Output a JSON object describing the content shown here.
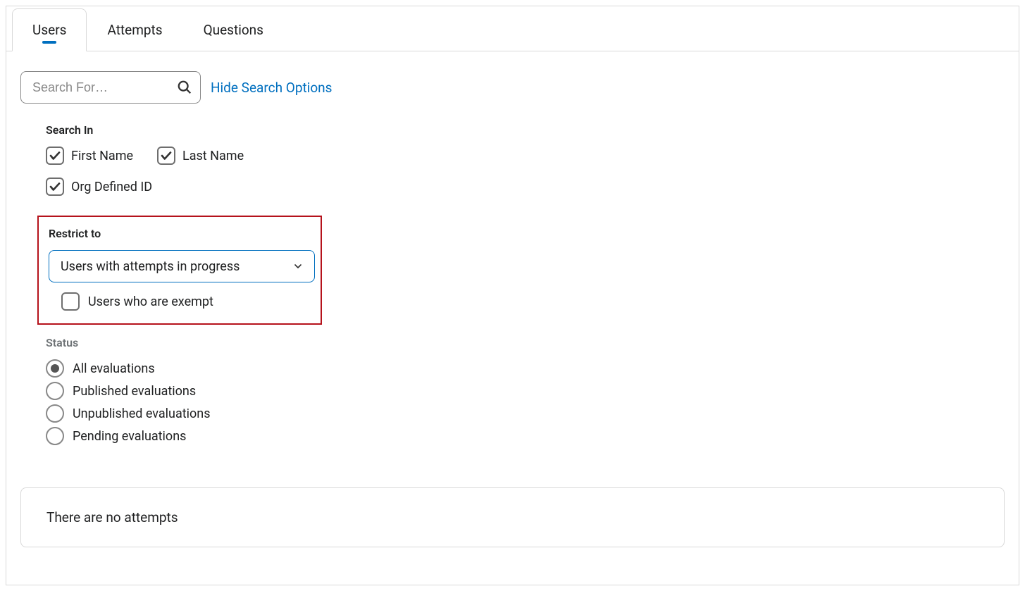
{
  "tabs": {
    "users": "Users",
    "attempts": "Attempts",
    "questions": "Questions"
  },
  "search": {
    "placeholder": "Search For…",
    "hide_options_label": "Hide Search Options"
  },
  "search_in": {
    "title": "Search In",
    "first_name": "First Name",
    "last_name": "Last Name",
    "org_id": "Org Defined ID"
  },
  "restrict": {
    "title": "Restrict to",
    "selected": "Users with attempts in progress",
    "exempt_label": "Users who are exempt"
  },
  "status": {
    "title": "Status",
    "all": "All evaluations",
    "published": "Published evaluations",
    "unpublished": "Unpublished evaluations",
    "pending": "Pending evaluations"
  },
  "empty_message": "There are no attempts"
}
